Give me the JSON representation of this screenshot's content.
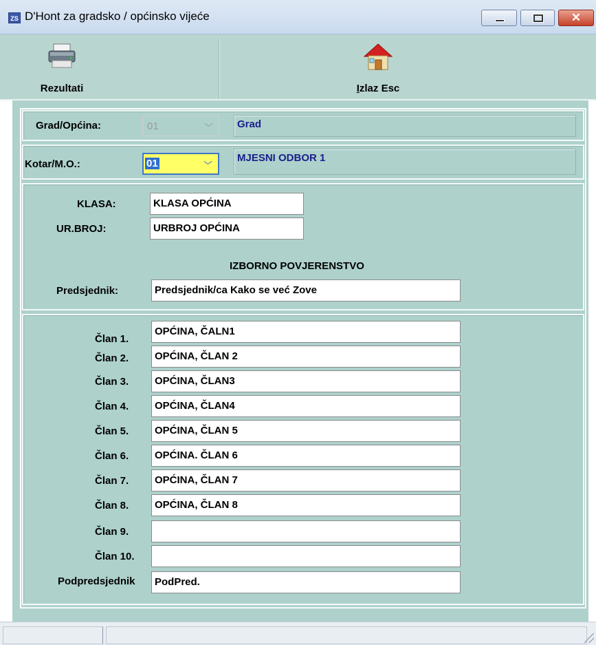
{
  "window": {
    "title": "D'Hont za gradsko / općinsko vijeće",
    "icon": "app-icon",
    "controls": [
      "minimize",
      "maximize",
      "close"
    ]
  },
  "toolbar": {
    "results_label": "Rezultati",
    "results_icon": "printer-icon",
    "exit_label": "Izlaz Esc",
    "exit_icon": "house-icon"
  },
  "location": {
    "grad_label": "Grad/Općina:",
    "grad_value": "01",
    "grad_name": "Grad",
    "kotar_label": "Kotar/M.O.:",
    "kotar_value": "01",
    "kotar_name": "MJESNI ODBOR 1"
  },
  "header": {
    "klasa_label": "KLASA:",
    "klasa_value": "KLASA OPĆINA",
    "urbroj_label": "UR.BROJ:",
    "urbroj_value": "URBROJ OPĆINA",
    "committee_heading": "IZBORNO POVJERENSTVO",
    "president_label": "Predsjednik:",
    "president_value": "Predsjednik/ca Kako se već Zove"
  },
  "members": [
    {
      "label": "Član 1.",
      "value": "OPĆINA, ČALN1"
    },
    {
      "label": "Član 2.",
      "value": "OPĆINA, ČLAN 2"
    },
    {
      "label": "Član 3.",
      "value": "OPĆINA, ČLAN3"
    },
    {
      "label": "Član 4.",
      "value": "OPĆINA, ČLAN4"
    },
    {
      "label": "Član 5.",
      "value": "OPĆINA, ČLAN 5"
    },
    {
      "label": "Član 6.",
      "value": "OPĆINA. ČLAN 6"
    },
    {
      "label": "Član 7.",
      "value": "OPĆINA, ČLAN 7"
    },
    {
      "label": "Član 8.",
      "value": "OPĆINA, ČLAN 8"
    },
    {
      "label": "Član 9.",
      "value": ""
    },
    {
      "label": "Član 10.",
      "value": ""
    }
  ],
  "vice": {
    "label": "Podpredsjednik",
    "value": "PodPred."
  },
  "colors": {
    "panel": "#aed1cc",
    "info_text": "#1a1f8a",
    "focus": "#ffff66"
  }
}
